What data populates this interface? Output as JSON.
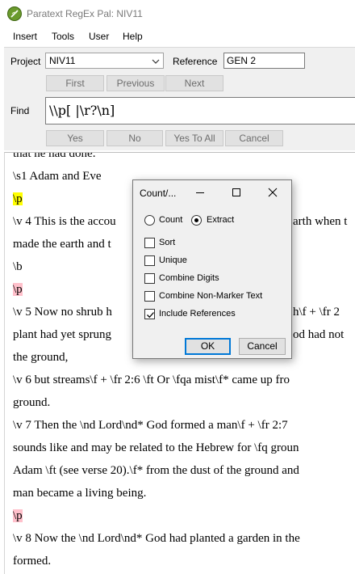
{
  "window": {
    "title": "Paratext RegEx Pal: NIV11"
  },
  "menu": [
    "Insert",
    "Tools",
    "User",
    "Help"
  ],
  "project": {
    "label": "Project",
    "value": "NIV11"
  },
  "reference": {
    "label": "Reference",
    "value": "GEN 2"
  },
  "nav_buttons": {
    "first": "First",
    "previous": "Previous",
    "next": "Next"
  },
  "find": {
    "label": "Find",
    "value": "\\\\p[ |\\r?\\n]"
  },
  "answer_buttons": {
    "yes": "Yes",
    "no": "No",
    "yes_to_all": "Yes To All",
    "cancel": "Cancel"
  },
  "document_lines": [
    "that he had done.",
    "\\s1 Adam and Eve",
    "\\p",
    "\\v 4 This is the accou",
    "made the earth and t",
    "\\b",
    "\\p",
    "\\v 5 Now no shrub h",
    "plant had yet sprung",
    "the ground,",
    "\\v 6 but streams\\f + \\fr 2:6 \\ft Or \\fqa mist\\f* came up fro",
    "ground.",
    "\\v 7 Then the \\nd Lord\\nd* God formed a man\\f + \\fr 2:7",
    "sounds like and may be related to the Hebrew for \\fq groun",
    "Adam \\ft (see verse 20).\\f* from the dust of the ground and",
    "man became a living being.",
    "\\p",
    "\\v 8 Now the \\nd Lord\\nd* God had planted a garden in the",
    "formed."
  ],
  "document_right_fragments": {
    "line4": "arth when t",
    "line8": "h\\f + \\fr 2",
    "line9": "od had not"
  },
  "dialog": {
    "title": "Count/...",
    "radio_count": "Count",
    "radio_extract": "Extract",
    "selected_mode": "Extract",
    "options": [
      {
        "label": "Sort",
        "checked": false
      },
      {
        "label": "Unique",
        "checked": false
      },
      {
        "label": "Combine Digits",
        "checked": false
      },
      {
        "label": "Combine Non-Marker Text",
        "checked": false
      },
      {
        "label": "Include References",
        "checked": true
      }
    ],
    "ok": "OK",
    "cancel": "Cancel"
  },
  "colors": {
    "yellow_highlight": "#ffff00",
    "pink_highlight": "#ffc0cb",
    "focus_blue": "#0078d7"
  }
}
